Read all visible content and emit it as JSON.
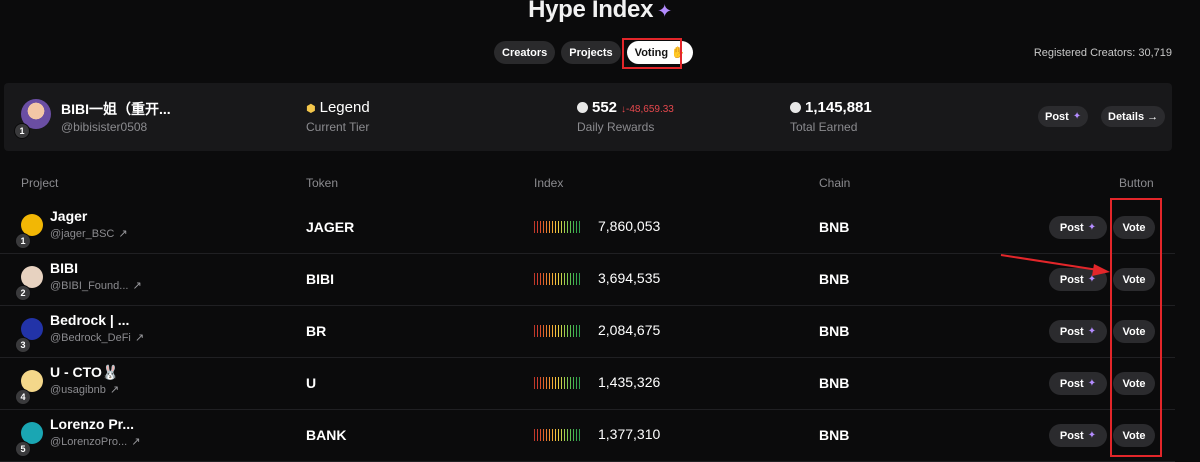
{
  "header": {
    "title": "Hype Index",
    "title_icon": "sparkle-icon",
    "tabs": [
      {
        "label": "Creators",
        "active": false
      },
      {
        "label": "Projects",
        "active": false
      },
      {
        "label": "Voting ✋",
        "active": true
      }
    ],
    "registered_creators": "Registered Creators: 30,719"
  },
  "top_creator": {
    "rank": "1",
    "name": "BIBI一姐（重开...",
    "handle": "@bibisister0508",
    "tier": "Legend",
    "tier_label": "Current Tier",
    "daily_rewards": "552",
    "daily_delta": "↓-48,659.33",
    "daily_rewards_label": "Daily Rewards",
    "total_earned": "1,145,881",
    "total_earned_label": "Total Earned",
    "post_label": "Post",
    "details_label": "Details →"
  },
  "table": {
    "columns": [
      "Project",
      "Token",
      "Index",
      "Chain",
      "Button"
    ],
    "post_label": "Post",
    "vote_label": "Vote",
    "rows": [
      {
        "rank": "1",
        "name": "Jager",
        "handle": "@jager_BSC",
        "token": "JAGER",
        "index": "7,860,053",
        "chain": "BNB",
        "avatar_color": "#f2b705",
        "index_level": 1.0
      },
      {
        "rank": "2",
        "name": "BIBI",
        "handle": "@BIBI_Found...",
        "token": "BIBI",
        "index": "3,694,535",
        "chain": "BNB",
        "avatar_color": "#e7d2c0",
        "index_level": 0.47
      },
      {
        "rank": "3",
        "name": "Bedrock | ...",
        "handle": "@Bedrock_DeFi",
        "token": "BR",
        "index": "2,084,675",
        "chain": "BNB",
        "avatar_color": "#2233a8",
        "index_level": 0.27
      },
      {
        "rank": "4",
        "name": "U - CTO🐰",
        "handle": "@usagibnb",
        "token": "U",
        "index": "1,435,326",
        "chain": "BNB",
        "avatar_color": "#f4d78a",
        "index_level": 0.18
      },
      {
        "rank": "5",
        "name": "Lorenzo Pr...",
        "handle": "@LorenzoPro...",
        "token": "BANK",
        "index": "1,377,310",
        "chain": "BNB",
        "avatar_color": "#1aa6b3",
        "index_level": 0.18
      }
    ]
  },
  "colors": {
    "accent_purple": "#b48cff",
    "annotation_red": "#e3262a",
    "delta_red": "#e5484d"
  }
}
